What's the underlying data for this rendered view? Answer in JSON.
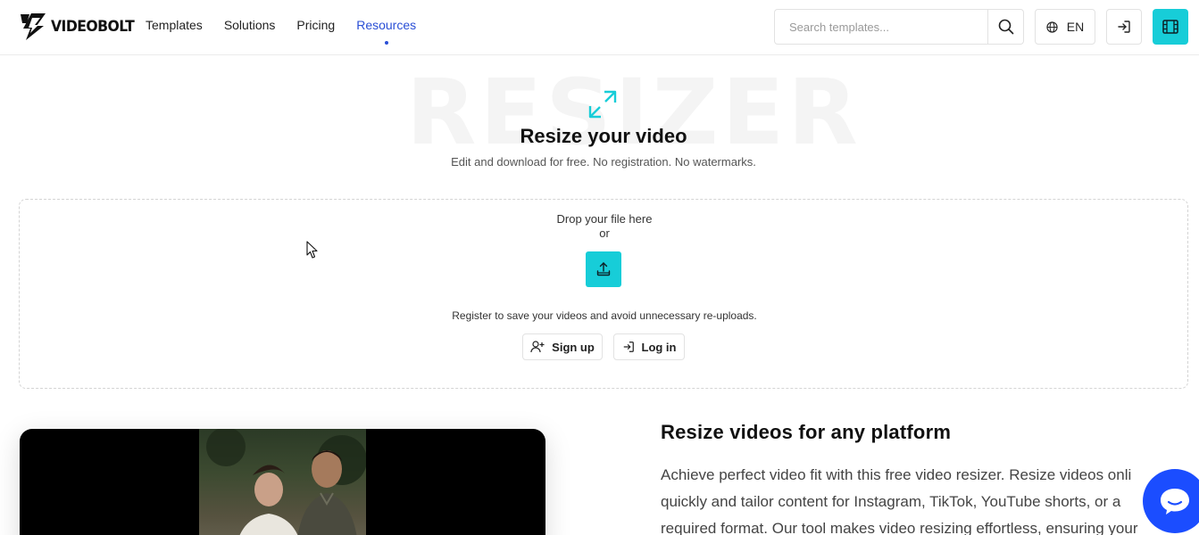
{
  "header": {
    "logo_text": "VIDEOBOLT",
    "nav": [
      {
        "label": "Templates",
        "active": false
      },
      {
        "label": "Solutions",
        "active": false
      },
      {
        "label": "Pricing",
        "active": false
      },
      {
        "label": "Resources",
        "active": true
      }
    ],
    "search_placeholder": "Search templates...",
    "language": "EN"
  },
  "hero": {
    "watermark": "RESIZER",
    "title": "Resize your video",
    "subtitle": "Edit and download for free. No registration. No watermarks."
  },
  "dropzone": {
    "drop_text": "Drop your file here",
    "or_text": "or",
    "register_text": "Register to save your videos and avoid unnecessary re-uploads.",
    "signup_label": "Sign up",
    "login_label": "Log in"
  },
  "section": {
    "title": "Resize videos for any platform",
    "body_lines": [
      "Achieve perfect video fit with this free video resizer. Resize videos onli",
      "quickly and tailor content for Instagram, TikTok, YouTube shorts, or a",
      "required format. Our tool makes video resizing effortless, ensuring your"
    ]
  },
  "colors": {
    "accent": "#17cdd8",
    "link_active": "#2a4fd6",
    "chat": "#1b4dff"
  }
}
